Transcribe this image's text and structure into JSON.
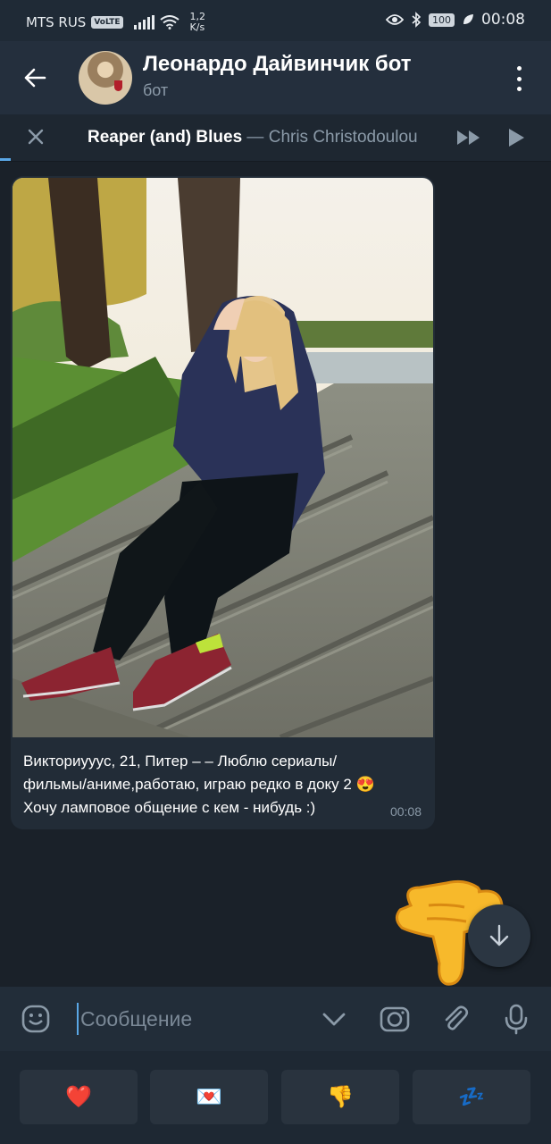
{
  "status_bar": {
    "carrier": "MTS RUS",
    "volte": "VoLTE",
    "speed_value": "1,2",
    "speed_unit": "K/s",
    "battery": "100",
    "time": "00:08"
  },
  "header": {
    "title": "Леонардо Дайвинчик бот",
    "subtitle": "бот"
  },
  "player": {
    "track_title": "Reaper (and) Blues",
    "separator": " — ",
    "artist": "Chris Christodoulou"
  },
  "message": {
    "text_line1": "Викториуууc, 21, Питер – – Люблю сериалы/",
    "text_line2": "фильмы/аниме,работаю, играю редко в доку 2 😍",
    "text_line3": "Хочу ламповое общение с кем - нибудь :)",
    "time": "00:08"
  },
  "composer": {
    "placeholder": "Сообщение"
  },
  "keyboard": {
    "buttons": [
      "❤️",
      "💌",
      "👎",
      "💤"
    ]
  },
  "colors": {
    "background": "#1a2129",
    "header": "#242f3d",
    "accent": "#5aa7e6",
    "secondary_text": "#8b9aa8"
  },
  "icons": {
    "back": "arrow-left-icon",
    "menu": "more-vertical-icon",
    "close": "close-icon",
    "fast_forward": "fast-forward-icon",
    "play": "play-icon",
    "emoji": "sticker-icon",
    "collapse": "chevron-down-icon",
    "camera": "camera-icon",
    "attach": "paperclip-icon",
    "mic": "microphone-icon",
    "scroll": "arrow-down-icon"
  }
}
